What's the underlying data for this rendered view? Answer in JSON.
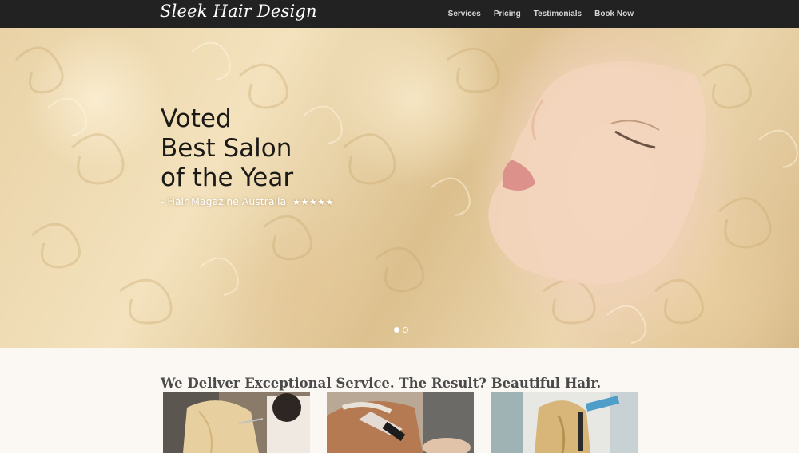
{
  "brand": {
    "logo_text": "Sleek Hair Design"
  },
  "nav": {
    "items": [
      {
        "label": "Services"
      },
      {
        "label": "Pricing"
      },
      {
        "label": "Testimonials"
      },
      {
        "label": "Book Now"
      }
    ]
  },
  "hero": {
    "title_lines": [
      "Voted",
      "Best Salon",
      "of the Year"
    ],
    "source": "- Hair Magazine Australia",
    "rating_stars": "★★★★★",
    "slides": {
      "count": 2,
      "active_index": 0
    }
  },
  "services": {
    "heading": "We Deliver Exceptional Service. The Result? Beautiful Hair.",
    "images": [
      {
        "name": "stylist-cutting-blonde-hair-photo"
      },
      {
        "name": "hair-coloring-foils-photo"
      },
      {
        "name": "stylist-curling-hair-photo"
      }
    ]
  },
  "colors": {
    "nav_bg": "#222222",
    "page_bg": "#fbf8f3",
    "hero_text": "#1c1a17"
  }
}
